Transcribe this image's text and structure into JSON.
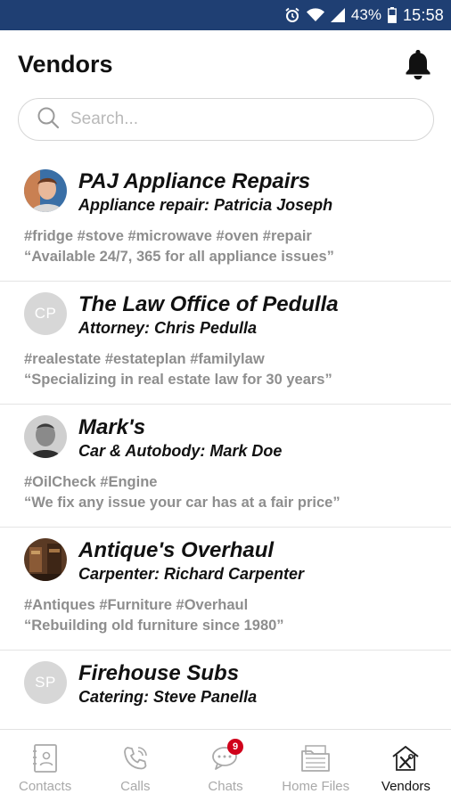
{
  "status_bar": {
    "battery": "43%",
    "time": "15:58",
    "icons": [
      "alarm-icon",
      "wifi-icon",
      "signal-icon",
      "battery-icon"
    ]
  },
  "header": {
    "title": "Vendors",
    "icon": "bell-icon"
  },
  "search": {
    "placeholder": "Search...",
    "value": ""
  },
  "vendors": [
    {
      "name": "PAJ Appliance Repairs",
      "role": "Appliance repair: Patricia Joseph",
      "tags": "#fridge #stove #microwave #oven #repair",
      "quote": "“Available 24/7, 365  for all appliance issues”",
      "avatar": "photo"
    },
    {
      "name": "The Law Office of Pedulla",
      "role": "Attorney: Chris Pedulla",
      "tags": "#realestate #estateplan #familylaw",
      "quote": "“Specializing in real estate law for 30 years”",
      "avatar_initials": "CP"
    },
    {
      "name": "Mark's",
      "role": "Car & Autobody: Mark Doe",
      "tags": "#OilCheck #Engine",
      "quote": "“We fix any issue your car has at a fair price”",
      "avatar": "photo"
    },
    {
      "name": "Antique's Overhaul",
      "role": "Carpenter: Richard Carpenter",
      "tags": "#Antiques #Furniture #Overhaul",
      "quote": "“Rebuilding old furniture since 1980”",
      "avatar": "photo"
    },
    {
      "name": "Firehouse Subs",
      "role": "Catering: Steve Panella",
      "avatar_initials": "SP"
    }
  ],
  "tabs": [
    {
      "label": "Contacts",
      "icon": "contacts-icon",
      "active": false
    },
    {
      "label": "Calls",
      "icon": "phone-icon",
      "active": false
    },
    {
      "label": "Chats",
      "icon": "chat-icon",
      "active": false,
      "badge": "9"
    },
    {
      "label": "Home Files",
      "icon": "files-icon",
      "active": false
    },
    {
      "label": "Vendors",
      "icon": "vendors-icon",
      "active": true
    }
  ],
  "colors": {
    "status_bar": "#1f3f73",
    "badge": "#d0021b",
    "muted_text": "#8e8e8e",
    "avatar_initials_bg": "#d7d7d7"
  }
}
